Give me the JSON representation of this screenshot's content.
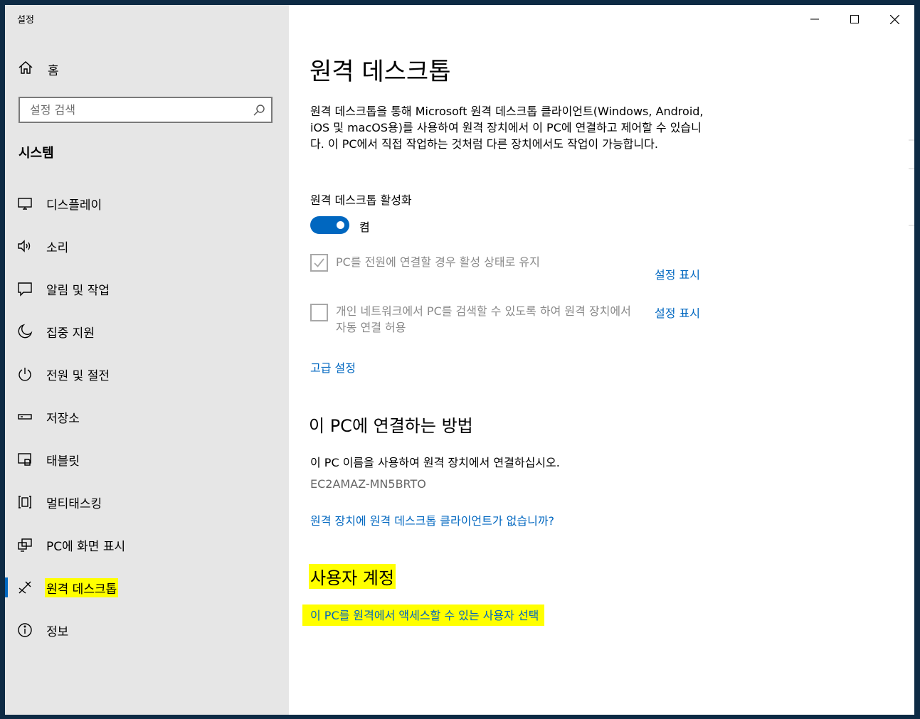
{
  "window": {
    "title": "설정"
  },
  "sidebar": {
    "home_label": "홈",
    "search_placeholder": "설정 검색",
    "section_title": "시스템",
    "items": [
      {
        "label": "디스플레이",
        "icon": "display-icon"
      },
      {
        "label": "소리",
        "icon": "speaker-icon"
      },
      {
        "label": "알림 및 작업",
        "icon": "notification-icon"
      },
      {
        "label": "집중 지원",
        "icon": "moon-icon"
      },
      {
        "label": "전원 및 절전",
        "icon": "power-icon"
      },
      {
        "label": "저장소",
        "icon": "storage-icon"
      },
      {
        "label": "태블릿",
        "icon": "tablet-icon"
      },
      {
        "label": "멀티태스킹",
        "icon": "multitasking-icon"
      },
      {
        "label": "PC에 화면 표시",
        "icon": "project-icon"
      },
      {
        "label": "원격 데스크톱",
        "icon": "remote-desktop-icon",
        "active": true
      },
      {
        "label": "정보",
        "icon": "info-icon"
      }
    ]
  },
  "main": {
    "title": "원격 데스크톱",
    "description": "원격 데스크톱을 통해 Microsoft 원격 데스크톱 클라이언트(Windows, Android, iOS 및 macOS용)를 사용하여 원격 장치에서 이 PC에 연결하고 제어할 수 있습니다. 이 PC에서 직접 작업하는 것처럼 다른 장치에서도 작업이 가능합니다.",
    "enable_label": "원격 데스크톱 활성화",
    "toggle_state": "켬",
    "toggle_on": true,
    "option1": {
      "text": "PC를 전원에 연결할 경우 활성 상태로 유지",
      "checked": true,
      "link": "설정 표시"
    },
    "option2": {
      "text": "개인 네트워크에서 PC를 검색할 수 있도록 하여 원격 장치에서 자동 연결 허용",
      "checked": false,
      "link": "설정 표시"
    },
    "advanced_link": "고급 설정",
    "connect_heading": "이 PC에 연결하는 방법",
    "connect_text": "이 PC 이름을 사용하여 원격 장치에서 연결하십시오.",
    "pc_name": "EC2AMAZ-MN5BRTO",
    "no_client_link": "원격 장치에 원격 데스크톱 클라이언트가 없습니까?",
    "accounts_heading": "사용자 계정",
    "select_users_link": "이 PC를 원격에서 액세스할 수 있는 사용자 선택"
  },
  "colors": {
    "accent": "#0067c0",
    "highlight": "#ffff00",
    "sidebar_bg": "#e6e6e6"
  }
}
